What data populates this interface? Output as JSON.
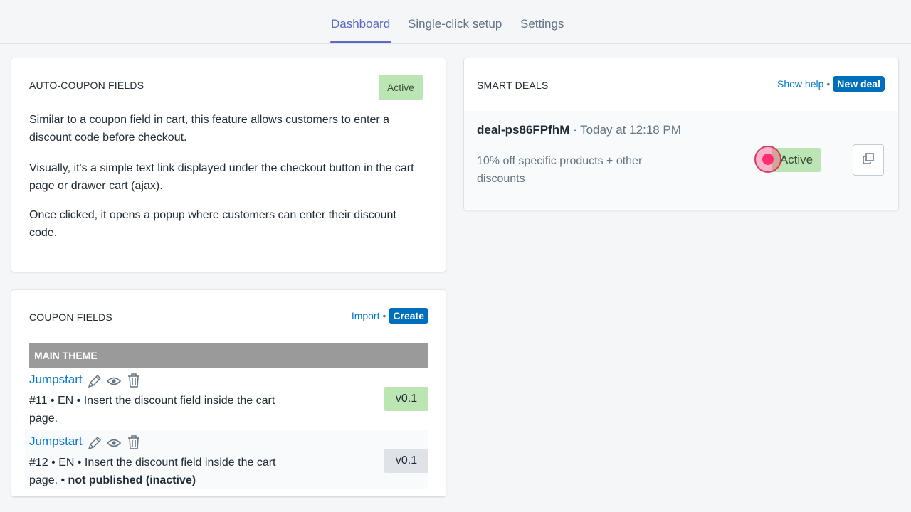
{
  "tabs": [
    {
      "label": "Dashboard",
      "active": true
    },
    {
      "label": "Single-click setup",
      "active": false
    },
    {
      "label": "Settings",
      "active": false
    }
  ],
  "auto_coupon": {
    "title": "AUTO-COUPON FIELDS",
    "status": "Active",
    "paragraphs": [
      "Similar to a coupon field in cart, this feature allows customers to enter a discount code before checkout.",
      "Visually, it's a simple text link displayed under the checkout button in the cart page or drawer cart (ajax).",
      "Once clicked, it opens a popup where customers can enter their discount code."
    ]
  },
  "coupon_fields": {
    "title": "COUPON FIELDS",
    "import_label": "Import",
    "separator": "•",
    "create_label": "Create",
    "theme_header": "MAIN THEME",
    "items": [
      {
        "name": "Jumpstart",
        "description": "#11 • EN • Insert the discount field inside the cart page.",
        "note": "",
        "version": "v0.1",
        "version_color": "#bbe5b3"
      },
      {
        "name": "Jumpstart",
        "description": "#12 • EN • Insert the discount field inside the cart page. •",
        "note": "not published (inactive)",
        "version": "v0.1",
        "version_color": "#dfe3e8"
      }
    ]
  },
  "smart_deals": {
    "title": "SMART DEALS",
    "show_help_label": "Show help",
    "separator": "•",
    "new_deal_label": "New deal",
    "deal": {
      "id": "deal-ps86FPfhM",
      "time": "- Today at 12:18 PM",
      "description": "10% off specific products + other discounts",
      "status": "Active"
    }
  },
  "colors": {
    "accent": "#5c6ac4",
    "link": "#007ace",
    "button": "#006fbb",
    "active_badge": "#bbe5b3",
    "cursor": "#ff2d6f"
  }
}
